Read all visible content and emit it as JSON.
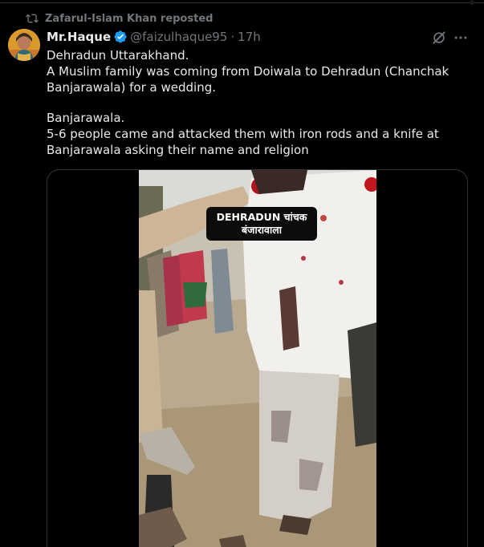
{
  "repost": {
    "text": "Zafarul-Islam Khan reposted",
    "icon": "repost-icon"
  },
  "tweet": {
    "author_name": "Mr.Haque",
    "verified": true,
    "handle": "@faizulhaque95",
    "separator": "·",
    "time": "17h",
    "paragraphs": [
      "Dehradun Uttarakhand.\nA Muslim family was coming from Doiwala to Dehradun (Chanchak Banjarawala) for a wedding.",
      "Banjarawala.\n5-6 people came and attacked them with iron rods and a knife at Banjarawala asking their name and religion"
    ]
  },
  "media": {
    "type": "video",
    "caption_line1": "DEHRADUN चांचक",
    "caption_line2": "बंजारावाला"
  },
  "colors": {
    "background": "#000000",
    "text_primary": "#e7e9ea",
    "text_secondary": "#71767b",
    "verified_blue": "#1d9bf0",
    "border": "#2f3336"
  },
  "icons": [
    "repost-icon",
    "verified-badge-icon",
    "grok-icon",
    "more-icon"
  ]
}
